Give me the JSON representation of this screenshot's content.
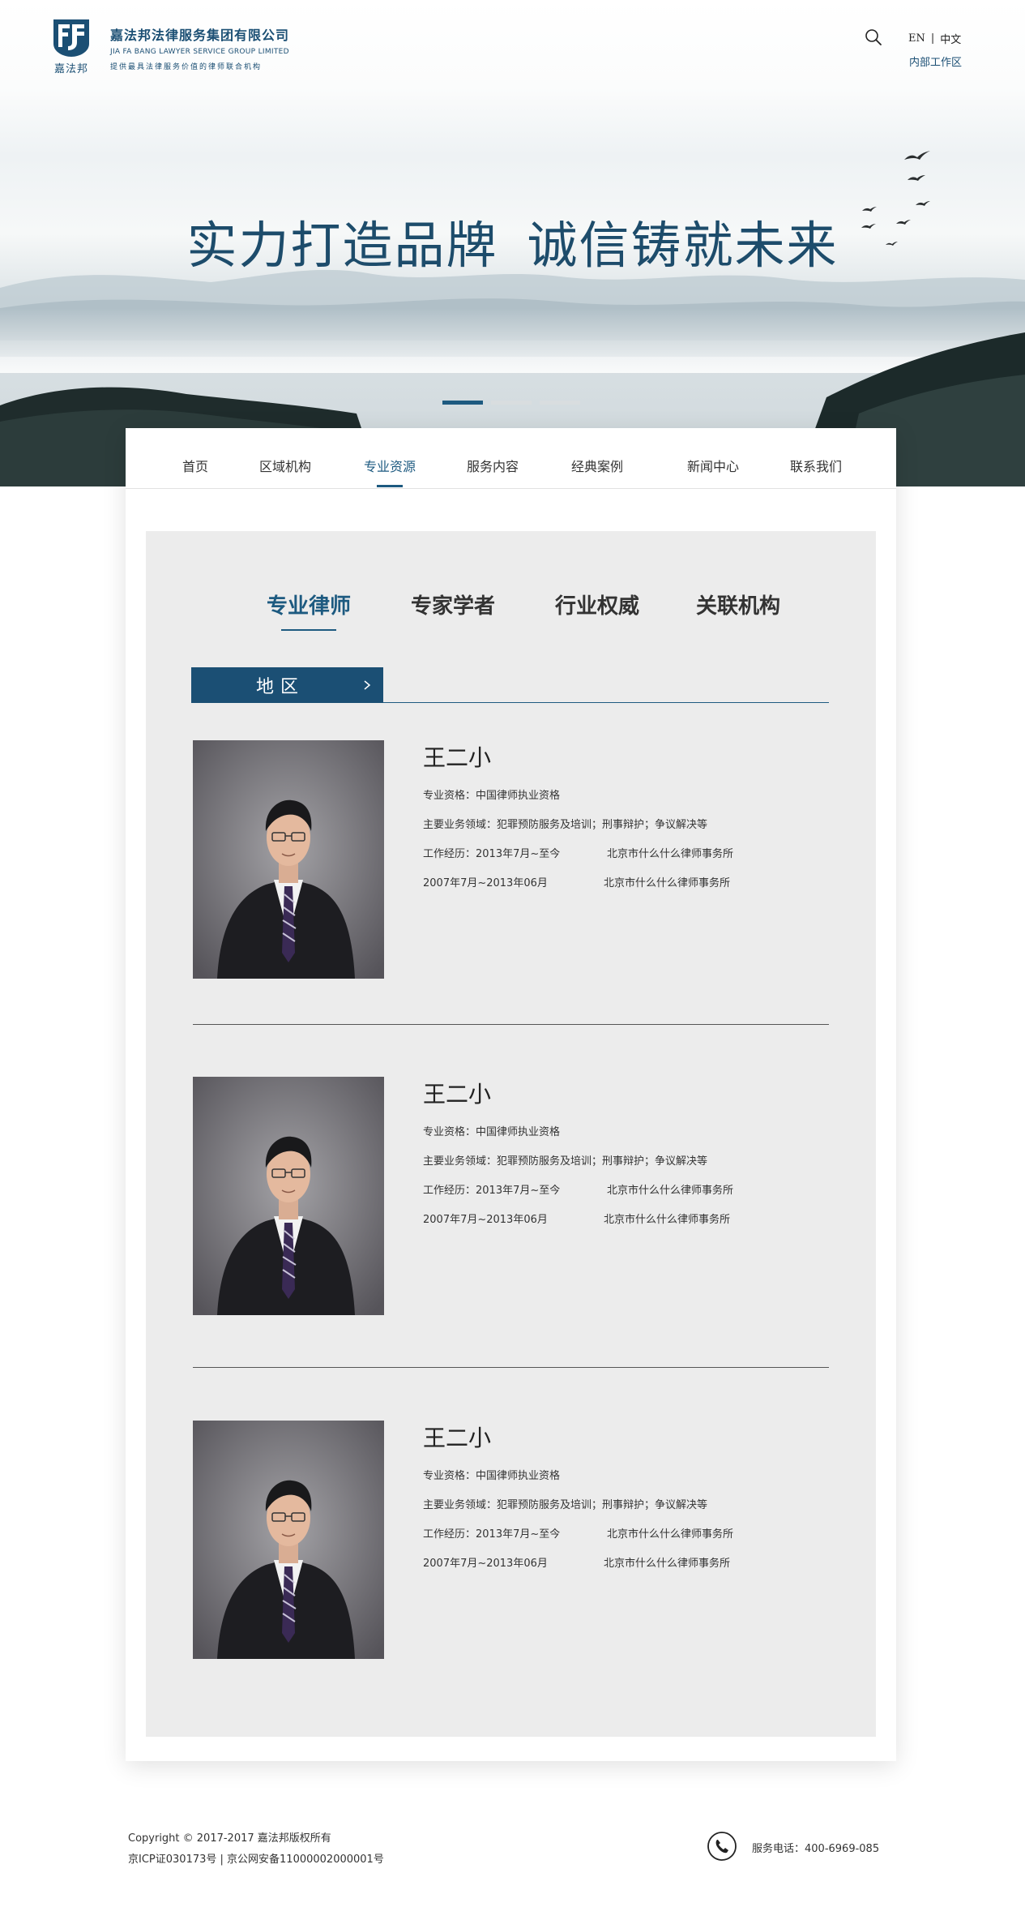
{
  "header": {
    "logo_mark_text": "嘉法邦",
    "logo_cn": "嘉法邦法律服务集团有限公司",
    "logo_en": "JIA FA BANG LAWYER SERVICE GROUP LIMITED",
    "logo_slogan": "提供最具法律服务价值的律师联合机构",
    "lang_en": "EN",
    "lang_sep": "|",
    "lang_cn": "中文",
    "internal": "内部工作区"
  },
  "hero": {
    "title_part1": "实力打造品牌",
    "title_part2": "诚信铸就未来",
    "slides": 3,
    "active_slide": 1
  },
  "nav": {
    "items": [
      "首页",
      "区域机构",
      "专业资源",
      "服务内容",
      "经典案例",
      "新闻中心",
      "联系我们"
    ],
    "active": "专业资源"
  },
  "subtabs": {
    "items": [
      "专业律师",
      "专家学者",
      "行业权威",
      "关联机构"
    ],
    "active": "专业律师"
  },
  "region": {
    "label": "地区"
  },
  "lawyers": [
    {
      "name": "王二小",
      "qualification": "专业资格：中国律师执业资格",
      "practice": "主要业务领域：犯罪预防服务及培训；刑事辩护；争议解决等",
      "exp1_period": "工作经历：2013年7月~至今",
      "exp1_org": "北京市什么什么律师事务所",
      "exp2_period": "2007年7月~2013年06月",
      "exp2_org": "北京市什么什么律师事务所"
    },
    {
      "name": "王二小",
      "qualification": "专业资格：中国律师执业资格",
      "practice": "主要业务领域：犯罪预防服务及培训；刑事辩护；争议解决等",
      "exp1_period": "工作经历：2013年7月~至今",
      "exp1_org": "北京市什么什么律师事务所",
      "exp2_period": "2007年7月~2013年06月",
      "exp2_org": "北京市什么什么律师事务所"
    },
    {
      "name": "王二小",
      "qualification": "专业资格：中国律师执业资格",
      "practice": "主要业务领域：犯罪预防服务及培训；刑事辩护；争议解决等",
      "exp1_period": "工作经历：2013年7月~至今",
      "exp1_org": "北京市什么什么律师事务所",
      "exp2_period": "2007年7月~2013年06月",
      "exp2_org": "北京市什么什么律师事务所"
    }
  ],
  "footer": {
    "copyright": "Copyright © 2017-2017 嘉法邦版权所有",
    "icp": "京ICP证030173号 | 京公网安备11000002000001号",
    "phone": "服务电话：400-6969-085"
  },
  "colors": {
    "brand": "#1b4f74",
    "accent": "#1d5a80",
    "panel_bg": "#ececec"
  },
  "icons": {
    "search": "search-icon",
    "phone": "phone-icon",
    "chevron": "chevron-right-icon"
  }
}
